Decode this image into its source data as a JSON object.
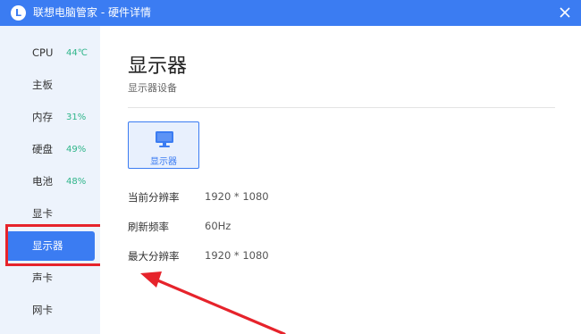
{
  "window": {
    "title": "联想电脑管家 - 硬件详情",
    "logo_letter": "L"
  },
  "sidebar": {
    "items": [
      {
        "label": "CPU",
        "metric": "44℃"
      },
      {
        "label": "主板",
        "metric": ""
      },
      {
        "label": "内存",
        "metric": "31%"
      },
      {
        "label": "硬盘",
        "metric": "49%"
      },
      {
        "label": "电池",
        "metric": "48%"
      },
      {
        "label": "显卡",
        "metric": ""
      },
      {
        "label": "显示器",
        "metric": "",
        "active": true
      },
      {
        "label": "声卡",
        "metric": ""
      },
      {
        "label": "网卡",
        "metric": ""
      }
    ]
  },
  "main": {
    "title": "显示器",
    "subtitle": "显示器设备",
    "devices": [
      {
        "label": "显示器"
      }
    ],
    "specs": [
      {
        "key": "当前分辨率",
        "value": "1920 * 1080"
      },
      {
        "key": "刷新频率",
        "value": "60Hz"
      },
      {
        "key": "最大分辨率",
        "value": "1920 * 1080"
      }
    ]
  },
  "colors": {
    "accent": "#3b7cf2",
    "sidebar_bg": "#edf3fc",
    "metric": "#2fb58a",
    "annotation": "#e6232b"
  },
  "icons": {
    "logo": "lenovo-l-logo",
    "close": "close-icon",
    "device": "monitor-icon"
  }
}
